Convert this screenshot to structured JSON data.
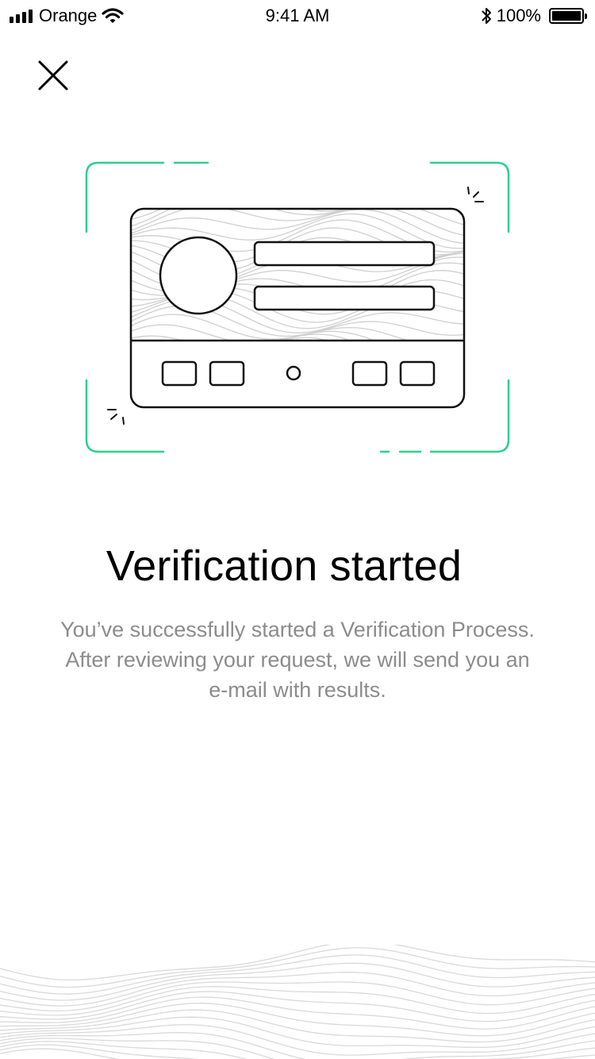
{
  "status_bar": {
    "carrier": "Orange",
    "time": "9:41 AM",
    "battery": "100%",
    "battery_level": 1.0
  },
  "close": {
    "icon": "close-icon"
  },
  "illustration": {
    "icon": "id-card-scan-icon",
    "frame_color": "#2ecf8f"
  },
  "content": {
    "title": "Verification started",
    "description": "You’ve successfully started a Verification Process. After reviewing your request, we will send you an e-mail with results."
  }
}
